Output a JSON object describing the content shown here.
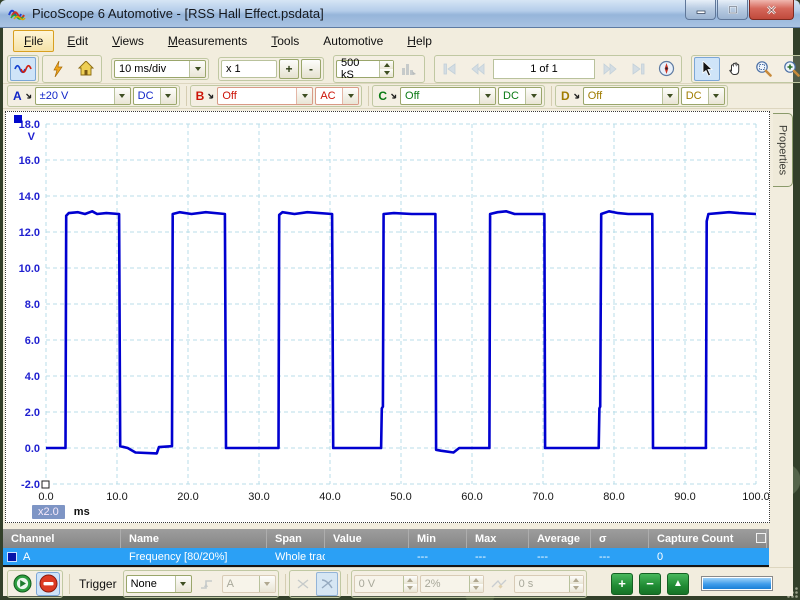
{
  "window": {
    "title": "PicoScope 6 Automotive - [RSS Hall Effect.psdata]",
    "buttons": [
      "minimize",
      "restore",
      "close"
    ]
  },
  "menu": {
    "items": [
      {
        "label": "File",
        "underline": true,
        "hot": true
      },
      {
        "label": "Edit",
        "underline": true,
        "hot": false
      },
      {
        "label": "Views",
        "underline": true,
        "hot": false
      },
      {
        "label": "Measurements",
        "underline": true,
        "hot": false
      },
      {
        "label": "Tools",
        "underline": true,
        "hot": false
      },
      {
        "label": "Automotive",
        "underline": false,
        "hot": false
      },
      {
        "label": "Help",
        "underline": true,
        "hot": false
      }
    ]
  },
  "toolbar": {
    "timebase": "10 ms/div",
    "zoom_factor": "x 1",
    "zoom_in_label": "+",
    "zoom_out_label": "-",
    "samples": "500 kS",
    "page_indicator": "1 of 1",
    "icons": [
      "waveform-mode-icon",
      "lightning-icon",
      "home-icon",
      "histogram-icon",
      "first-page-icon",
      "prev-page-icon",
      "next-page-icon",
      "last-page-icon",
      "compass-icon",
      "cursor-tool-icon",
      "hand-tool-icon",
      "zoom-window-icon",
      "zoom-in-icon",
      "zoom-out-icon",
      "undo-zoom-icon",
      "zoom-100-icon"
    ]
  },
  "channels": [
    {
      "id": "A",
      "range": "±20 V",
      "coupling": "DC",
      "color": "#1024c8"
    },
    {
      "id": "B",
      "range": "Off",
      "coupling": "AC",
      "color": "#cc1408"
    },
    {
      "id": "C",
      "range": "Off",
      "coupling": "DC",
      "color": "#0a7a14"
    },
    {
      "id": "D",
      "range": "Off",
      "coupling": "DC",
      "color": "#a07c00"
    }
  ],
  "chart_data": {
    "type": "line",
    "title": "",
    "xlabel": "ms",
    "ylabel": "V",
    "xlim": [
      0,
      100
    ],
    "ylim": [
      -2,
      18
    ],
    "grid": "dashed",
    "zoom_badge": "x2.0",
    "x_ticks": [
      {
        "v": 0,
        "label": "0.0"
      },
      {
        "v": 10,
        "label": "10.0"
      },
      {
        "v": 20,
        "label": "20.0"
      },
      {
        "v": 30,
        "label": "30.0"
      },
      {
        "v": 40,
        "label": "40.0"
      },
      {
        "v": 50,
        "label": "50.0"
      },
      {
        "v": 60,
        "label": "60.0"
      },
      {
        "v": 70,
        "label": "70.0"
      },
      {
        "v": 80,
        "label": "80.0"
      },
      {
        "v": 90,
        "label": "90.0"
      },
      {
        "v": 100,
        "label": "100.0"
      }
    ],
    "y_ticks": [
      {
        "v": 18,
        "label": "18.0"
      },
      {
        "v": 16,
        "label": "16.0"
      },
      {
        "v": 14,
        "label": "14.0"
      },
      {
        "v": 12,
        "label": "12.0"
      },
      {
        "v": 10,
        "label": "10.0"
      },
      {
        "v": 8,
        "label": "8.0"
      },
      {
        "v": 6,
        "label": "6.0"
      },
      {
        "v": 4,
        "label": "4.0"
      },
      {
        "v": 2,
        "label": "2.0"
      },
      {
        "v": 0,
        "label": "0.0"
      },
      {
        "v": -2,
        "label": "-2.0"
      }
    ],
    "series": [
      {
        "name": "A",
        "color": "#0000d0",
        "high_level_v": 13.0,
        "low_level_v": 0.0,
        "points": [
          [
            0,
            0
          ],
          [
            2.75,
            0
          ],
          [
            2.85,
            12.9
          ],
          [
            3.2,
            13.05
          ],
          [
            4.5,
            13.1
          ],
          [
            5.5,
            13.0
          ],
          [
            6.5,
            13.15
          ],
          [
            7.2,
            13.0
          ],
          [
            8.5,
            13.05
          ],
          [
            10.3,
            13.0
          ],
          [
            10.45,
            0.1
          ],
          [
            11.5,
            0.0
          ],
          [
            12.6,
            -0.25
          ],
          [
            15.6,
            -0.3
          ],
          [
            15.9,
            0.05
          ],
          [
            17.75,
            0.1
          ],
          [
            17.85,
            13.0
          ],
          [
            18.8,
            13.1
          ],
          [
            20.5,
            13.0
          ],
          [
            22.5,
            13.1
          ],
          [
            25.2,
            13.0
          ],
          [
            25.35,
            0.0
          ],
          [
            32.75,
            0.0
          ],
          [
            32.85,
            12.95
          ],
          [
            33.3,
            13.1
          ],
          [
            35,
            13.0
          ],
          [
            36.8,
            13.1
          ],
          [
            40.3,
            13.0
          ],
          [
            40.45,
            0.0
          ],
          [
            47.2,
            0.0
          ],
          [
            47.3,
            2.2
          ],
          [
            47.45,
            2.3
          ],
          [
            47.55,
            13.0
          ],
          [
            49,
            13.05
          ],
          [
            51.5,
            13.0
          ],
          [
            54.85,
            13.0
          ],
          [
            54.95,
            -0.1
          ],
          [
            55.6,
            -0.15
          ],
          [
            57.4,
            -0.25
          ],
          [
            58.2,
            0.0
          ],
          [
            62.45,
            0.0
          ],
          [
            62.55,
            13.0
          ],
          [
            63.6,
            13.1
          ],
          [
            64.8,
            13.15
          ],
          [
            66,
            13.0
          ],
          [
            70.2,
            13.0
          ],
          [
            70.3,
            0.0
          ],
          [
            77.85,
            0.0
          ],
          [
            77.95,
            2.2
          ],
          [
            78.05,
            2.3
          ],
          [
            78.2,
            13.0
          ],
          [
            79.3,
            13.15
          ],
          [
            80.6,
            13.05
          ],
          [
            82,
            13.0
          ],
          [
            85.4,
            13.0
          ],
          [
            85.5,
            0.0
          ],
          [
            92.95,
            0.0
          ],
          [
            93.05,
            12.6
          ],
          [
            93.3,
            13.0
          ],
          [
            94.8,
            13.05
          ],
          [
            96.2,
            13.1
          ],
          [
            97.6,
            13.05
          ],
          [
            100,
            13.0
          ]
        ]
      }
    ]
  },
  "properties_tab": "Properties",
  "table": {
    "columns": [
      "Channel",
      "Name",
      "Span",
      "Value",
      "Min",
      "Max",
      "Average",
      "σ",
      "Capture Count"
    ],
    "rows": [
      [
        "A",
        "Frequency  [80/20%]",
        "Whole trace",
        "",
        "---",
        "---",
        "---",
        "---",
        "0"
      ]
    ]
  },
  "bottom_toolbar": {
    "trigger_label": "Trigger",
    "trigger_mode": "None",
    "source": "A",
    "level": "0 V",
    "hysteresis": "2%",
    "delay": "0 s",
    "add_label": "+",
    "remove_label": "−",
    "up_label": "▲",
    "icons": [
      "start-capture-icon",
      "stop-capture-icon",
      "edge-rising-icon",
      "marker-falling-icon",
      "marker-auto-icon",
      "adv-trigger-icon"
    ]
  }
}
